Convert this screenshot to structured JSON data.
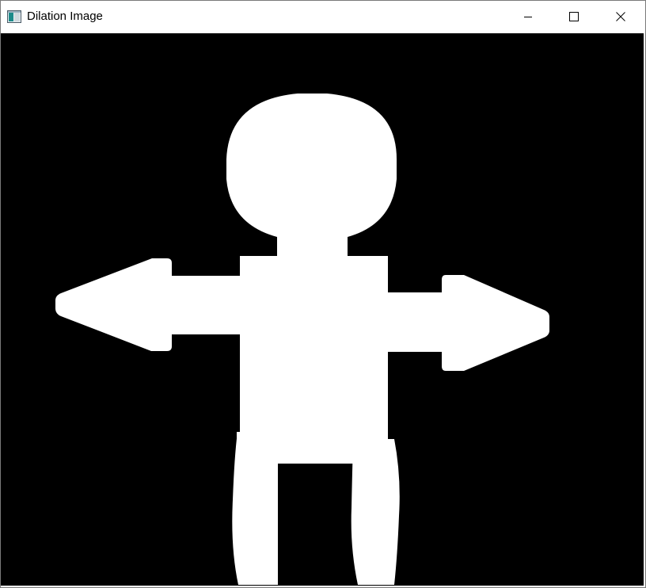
{
  "window": {
    "title": "Dilation Image",
    "app_icon": "app-icon",
    "controls": {
      "minimize_icon": "minimize-icon",
      "maximize_icon": "maximize-icon",
      "close_icon": "close-icon"
    }
  },
  "image": {
    "background_color": "#000000",
    "foreground_color": "#ffffff"
  }
}
